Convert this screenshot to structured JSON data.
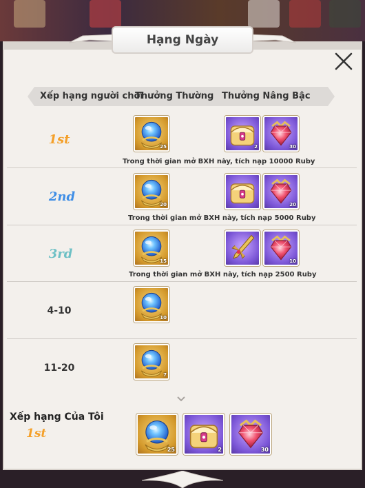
{
  "header": {
    "title": "Hạng Ngày"
  },
  "columns": {
    "rank": "Xếp hạng người chơi",
    "normal_reward": "Thưởng Thường",
    "upgrade_reward": "Thưởng Nâng Bậc"
  },
  "rows": [
    {
      "rank": "1st",
      "normal": [
        {
          "icon": "blue-orb-icon",
          "qty": "25"
        }
      ],
      "upgrade": [
        {
          "icon": "treasure-chest-icon",
          "qty": "2"
        },
        {
          "icon": "red-gem-icon",
          "qty": "30"
        }
      ],
      "note": "Trong thời gian mở BXH này, tích nạp 10000 Ruby"
    },
    {
      "rank": "2nd",
      "normal": [
        {
          "icon": "blue-orb-icon",
          "qty": "20"
        }
      ],
      "upgrade": [
        {
          "icon": "treasure-chest-icon",
          "qty": ""
        },
        {
          "icon": "red-gem-icon",
          "qty": "20"
        }
      ],
      "note": "Trong thời gian mở BXH này, tích nạp 5000 Ruby"
    },
    {
      "rank": "3rd",
      "normal": [
        {
          "icon": "blue-orb-icon",
          "qty": "15"
        }
      ],
      "upgrade": [
        {
          "icon": "golden-weapon-icon",
          "qty": ""
        },
        {
          "icon": "red-gem-icon",
          "qty": "10"
        }
      ],
      "note": "Trong thời gian mở BXH này, tích nạp 2500 Ruby"
    },
    {
      "rank": "4-10",
      "normal": [
        {
          "icon": "blue-orb-icon",
          "qty": "10"
        }
      ]
    },
    {
      "rank": "11-20",
      "normal": [
        {
          "icon": "blue-orb-icon",
          "qty": "7"
        }
      ]
    }
  ],
  "my_rank": {
    "label": "Xếp hạng Của Tôi",
    "rank": "1st",
    "rewards": [
      {
        "icon": "blue-orb-icon",
        "qty": "25"
      },
      {
        "icon": "treasure-chest-icon",
        "qty": "2"
      },
      {
        "icon": "red-gem-icon",
        "qty": "30"
      }
    ]
  },
  "colors": {
    "rank1": "#f4a02a",
    "rank2": "#3f8ee6",
    "rank3": "#6dc0c5"
  },
  "icons": [
    "close-icon",
    "chevron-down-icon"
  ]
}
